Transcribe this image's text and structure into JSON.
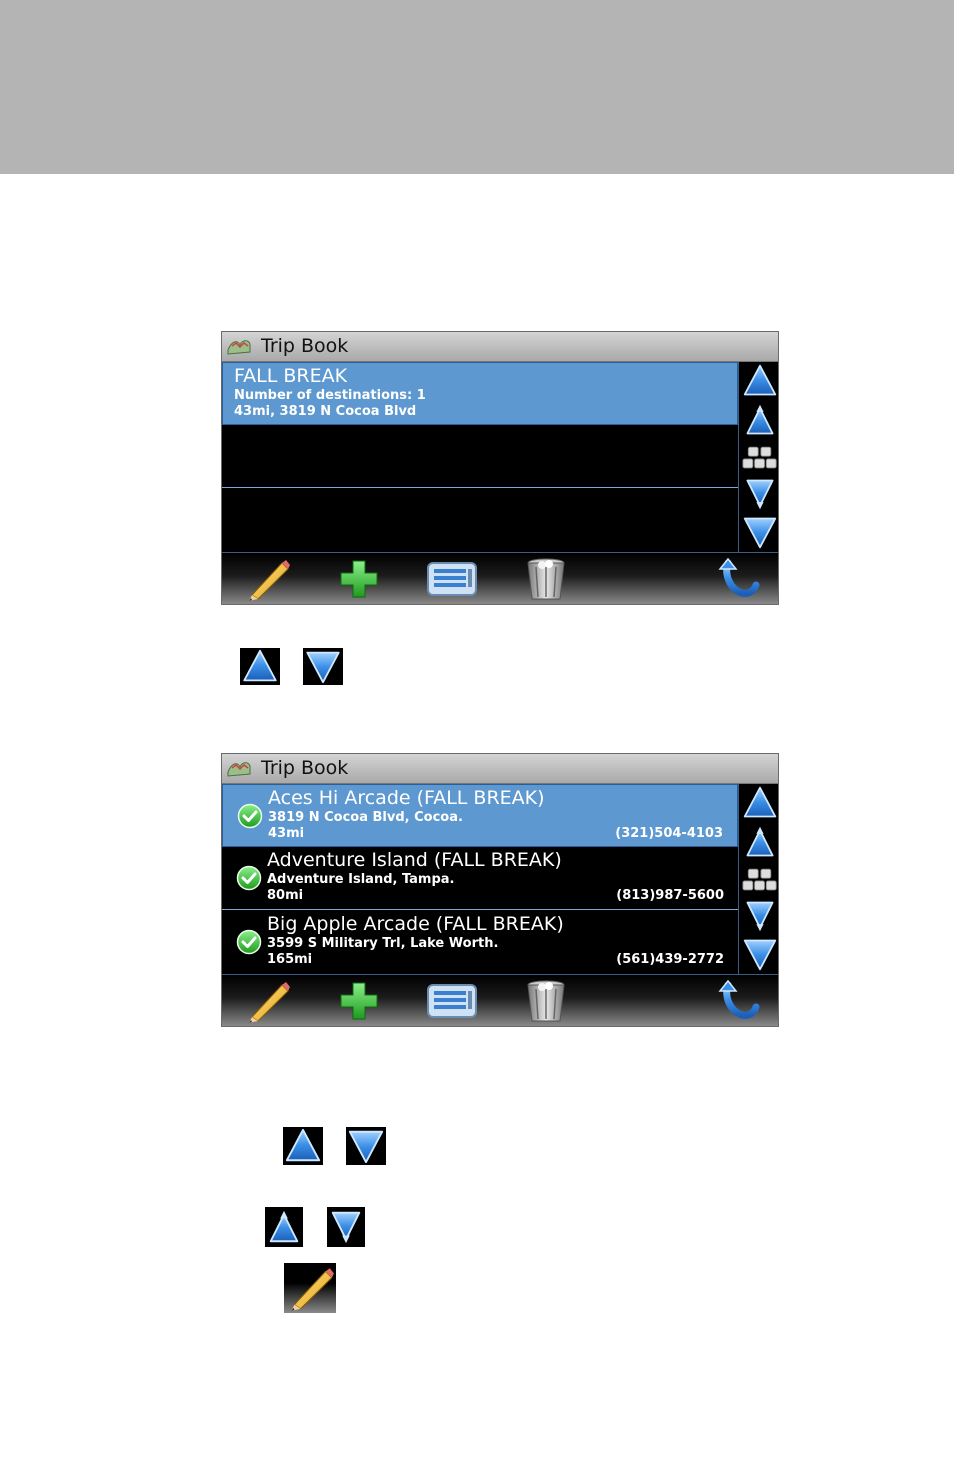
{
  "screens": [
    {
      "title": "Trip Book",
      "rows": [
        {
          "title": "FALL BREAK",
          "line1": "Number of destinations: 1",
          "line2": "43mi, 3819 N Cocoa Blvd",
          "phone": "",
          "selected": true
        }
      ]
    },
    {
      "title": "Trip Book",
      "rows": [
        {
          "title": "Aces Hi Arcade (FALL BREAK)",
          "line1": "3819 N Cocoa Blvd, Cocoa.",
          "line2": "43mi",
          "phone": "(321)504-4103",
          "selected": true
        },
        {
          "title": "Adventure Island (FALL BREAK)",
          "line1": "Adventure Island, Tampa.",
          "line2": "80mi",
          "phone": "(813)987-5600",
          "selected": false
        },
        {
          "title": "Big Apple Arcade (FALL BREAK)",
          "line1": "3599 S Military Trl, Lake Worth.",
          "line2": "165mi",
          "phone": "(561)439-2772",
          "selected": false
        }
      ]
    }
  ],
  "icons": {
    "title": "trip-book-map-icon",
    "scroll": [
      "page-up-icon",
      "line-up-icon",
      "keyboard-icon",
      "line-down-icon",
      "page-down-icon"
    ],
    "toolbar": [
      "pencil-edit-icon",
      "plus-add-icon",
      "list-icon",
      "trash-icon",
      "back-arrow-icon"
    ],
    "check": "check-circle-icon"
  },
  "colors": {
    "selected_row": "#5e98d0",
    "arrow_blue": "#3a8ee6",
    "add_green": "#2fb52f",
    "title_bar": "#c0c0c0",
    "top_band": "#b4b4b4"
  }
}
